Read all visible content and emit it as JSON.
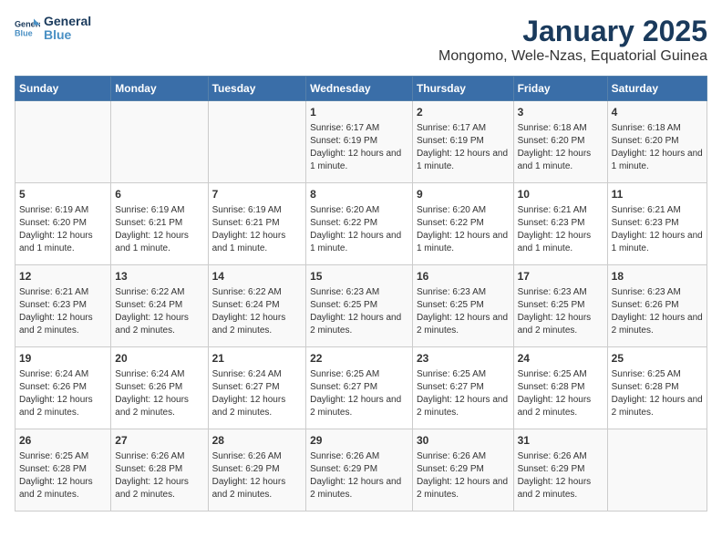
{
  "header": {
    "logo_line1": "General",
    "logo_line2": "Blue",
    "title": "January 2025",
    "subtitle": "Mongomo, Wele-Nzas, Equatorial Guinea"
  },
  "days_of_week": [
    "Sunday",
    "Monday",
    "Tuesday",
    "Wednesday",
    "Thursday",
    "Friday",
    "Saturday"
  ],
  "weeks": [
    [
      {
        "day": "",
        "info": ""
      },
      {
        "day": "",
        "info": ""
      },
      {
        "day": "",
        "info": ""
      },
      {
        "day": "1",
        "info": "Sunrise: 6:17 AM\nSunset: 6:19 PM\nDaylight: 12 hours and 1 minute."
      },
      {
        "day": "2",
        "info": "Sunrise: 6:17 AM\nSunset: 6:19 PM\nDaylight: 12 hours and 1 minute."
      },
      {
        "day": "3",
        "info": "Sunrise: 6:18 AM\nSunset: 6:20 PM\nDaylight: 12 hours and 1 minute."
      },
      {
        "day": "4",
        "info": "Sunrise: 6:18 AM\nSunset: 6:20 PM\nDaylight: 12 hours and 1 minute."
      }
    ],
    [
      {
        "day": "5",
        "info": "Sunrise: 6:19 AM\nSunset: 6:20 PM\nDaylight: 12 hours and 1 minute."
      },
      {
        "day": "6",
        "info": "Sunrise: 6:19 AM\nSunset: 6:21 PM\nDaylight: 12 hours and 1 minute."
      },
      {
        "day": "7",
        "info": "Sunrise: 6:19 AM\nSunset: 6:21 PM\nDaylight: 12 hours and 1 minute."
      },
      {
        "day": "8",
        "info": "Sunrise: 6:20 AM\nSunset: 6:22 PM\nDaylight: 12 hours and 1 minute."
      },
      {
        "day": "9",
        "info": "Sunrise: 6:20 AM\nSunset: 6:22 PM\nDaylight: 12 hours and 1 minute."
      },
      {
        "day": "10",
        "info": "Sunrise: 6:21 AM\nSunset: 6:23 PM\nDaylight: 12 hours and 1 minute."
      },
      {
        "day": "11",
        "info": "Sunrise: 6:21 AM\nSunset: 6:23 PM\nDaylight: 12 hours and 1 minute."
      }
    ],
    [
      {
        "day": "12",
        "info": "Sunrise: 6:21 AM\nSunset: 6:23 PM\nDaylight: 12 hours and 2 minutes."
      },
      {
        "day": "13",
        "info": "Sunrise: 6:22 AM\nSunset: 6:24 PM\nDaylight: 12 hours and 2 minutes."
      },
      {
        "day": "14",
        "info": "Sunrise: 6:22 AM\nSunset: 6:24 PM\nDaylight: 12 hours and 2 minutes."
      },
      {
        "day": "15",
        "info": "Sunrise: 6:23 AM\nSunset: 6:25 PM\nDaylight: 12 hours and 2 minutes."
      },
      {
        "day": "16",
        "info": "Sunrise: 6:23 AM\nSunset: 6:25 PM\nDaylight: 12 hours and 2 minutes."
      },
      {
        "day": "17",
        "info": "Sunrise: 6:23 AM\nSunset: 6:25 PM\nDaylight: 12 hours and 2 minutes."
      },
      {
        "day": "18",
        "info": "Sunrise: 6:23 AM\nSunset: 6:26 PM\nDaylight: 12 hours and 2 minutes."
      }
    ],
    [
      {
        "day": "19",
        "info": "Sunrise: 6:24 AM\nSunset: 6:26 PM\nDaylight: 12 hours and 2 minutes."
      },
      {
        "day": "20",
        "info": "Sunrise: 6:24 AM\nSunset: 6:26 PM\nDaylight: 12 hours and 2 minutes."
      },
      {
        "day": "21",
        "info": "Sunrise: 6:24 AM\nSunset: 6:27 PM\nDaylight: 12 hours and 2 minutes."
      },
      {
        "day": "22",
        "info": "Sunrise: 6:25 AM\nSunset: 6:27 PM\nDaylight: 12 hours and 2 minutes."
      },
      {
        "day": "23",
        "info": "Sunrise: 6:25 AM\nSunset: 6:27 PM\nDaylight: 12 hours and 2 minutes."
      },
      {
        "day": "24",
        "info": "Sunrise: 6:25 AM\nSunset: 6:28 PM\nDaylight: 12 hours and 2 minutes."
      },
      {
        "day": "25",
        "info": "Sunrise: 6:25 AM\nSunset: 6:28 PM\nDaylight: 12 hours and 2 minutes."
      }
    ],
    [
      {
        "day": "26",
        "info": "Sunrise: 6:25 AM\nSunset: 6:28 PM\nDaylight: 12 hours and 2 minutes."
      },
      {
        "day": "27",
        "info": "Sunrise: 6:26 AM\nSunset: 6:28 PM\nDaylight: 12 hours and 2 minutes."
      },
      {
        "day": "28",
        "info": "Sunrise: 6:26 AM\nSunset: 6:29 PM\nDaylight: 12 hours and 2 minutes."
      },
      {
        "day": "29",
        "info": "Sunrise: 6:26 AM\nSunset: 6:29 PM\nDaylight: 12 hours and 2 minutes."
      },
      {
        "day": "30",
        "info": "Sunrise: 6:26 AM\nSunset: 6:29 PM\nDaylight: 12 hours and 2 minutes."
      },
      {
        "day": "31",
        "info": "Sunrise: 6:26 AM\nSunset: 6:29 PM\nDaylight: 12 hours and 2 minutes."
      },
      {
        "day": "",
        "info": ""
      }
    ]
  ]
}
